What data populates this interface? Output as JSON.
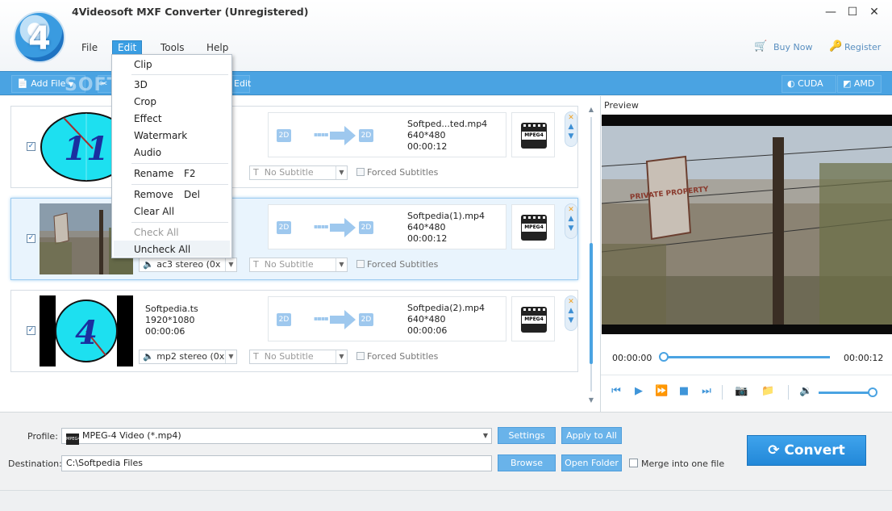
{
  "window": {
    "title": "4Videosoft MXF Converter (Unregistered)",
    "logo_digit": "4",
    "minimize": "—",
    "maximize": "☐",
    "close": "✕"
  },
  "menu": {
    "file": "File",
    "edit": "Edit",
    "tools": "Tools",
    "help": "Help"
  },
  "header_links": {
    "buy_now": "Buy Now",
    "register": "Register"
  },
  "toolbar": {
    "add_file": "Add File",
    "edit": "Edit",
    "watermark_text": "SOFTPEDIA",
    "cuda": "CUDA",
    "amd": "AMD"
  },
  "edit_menu": {
    "clip": "Clip",
    "threed": "3D",
    "crop": "Crop",
    "effect": "Effect",
    "watermark": "Watermark",
    "audio": "Audio",
    "rename": "Rename",
    "rename_shortcut": "F2",
    "remove": "Remove",
    "remove_shortcut": "Del",
    "clear_all": "Clear All",
    "check_all": "Check All",
    "uncheck_all": "Uncheck All"
  },
  "files": [
    {
      "thumb_label": "11",
      "source_name": "",
      "source_res": "",
      "source_dur": "",
      "in_badge": "2D",
      "out_badge": "2D",
      "out_name": "Softped...ted.mp4",
      "out_res": "640*480",
      "out_dur": "00:00:12",
      "format_icon": "MPEG4",
      "audio": "",
      "subtitle": "No Subtitle",
      "forced": "Forced Subtitles"
    },
    {
      "thumb_label": "",
      "source_name": "",
      "source_res": "",
      "source_dur": "",
      "in_badge": "2D",
      "out_badge": "2D",
      "out_name": "Softpedia(1).mp4",
      "out_res": "640*480",
      "out_dur": "00:00:12",
      "format_icon": "MPEG4",
      "audio": "ac3 stereo (0x",
      "subtitle": "No Subtitle",
      "forced": "Forced Subtitles"
    },
    {
      "thumb_label": "4",
      "source_name": "Softpedia.ts",
      "source_res": "1920*1080",
      "source_dur": "00:00:06",
      "in_badge": "2D",
      "out_badge": "2D",
      "out_name": "Softpedia(2).mp4",
      "out_res": "640*480",
      "out_dur": "00:00:06",
      "format_icon": "MPEG4",
      "audio": "mp2 stereo (0x",
      "subtitle": "No Subtitle",
      "forced": "Forced Subtitles"
    }
  ],
  "preview": {
    "label": "Preview",
    "sign_text": "PRIVATE PROPERTY",
    "time_current": "00:00:00",
    "time_total": "00:00:12",
    "progress": 0,
    "volume": 0.95
  },
  "bottom": {
    "profile_label": "Profile:",
    "profile_value": "MPEG-4 Video (*.mp4)",
    "profile_icon": "MPEG4",
    "settings": "Settings",
    "apply_to_all": "Apply to All",
    "destination_label": "Destination:",
    "destination_value": "C:\\Softpedia Files",
    "browse": "Browse",
    "open_folder": "Open Folder",
    "merge": "Merge into one file",
    "convert": "Convert"
  }
}
